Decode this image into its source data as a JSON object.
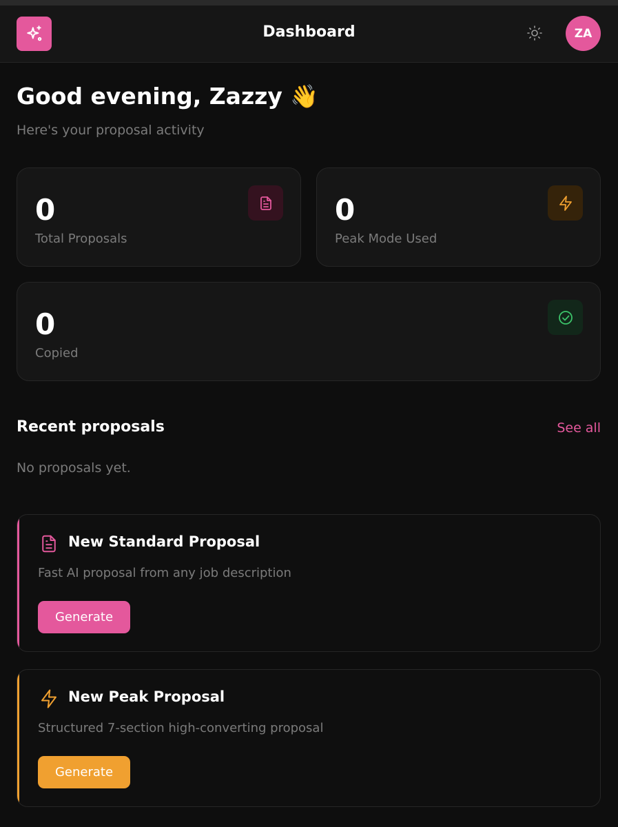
{
  "header": {
    "title": "Dashboard",
    "logo_icon": "sparkles-icon",
    "theme_icon": "sun-icon",
    "avatar_initials": "ZA"
  },
  "greeting": {
    "title": "Good evening, Zazzy 👋",
    "subtitle": "Here's your proposal activity"
  },
  "stats": [
    {
      "value": "0",
      "label": "Total Proposals",
      "icon": "document-icon",
      "color": "#e4589c"
    },
    {
      "value": "0",
      "label": "Peak Mode Used",
      "icon": "lightning-icon",
      "color": "#f0a030"
    },
    {
      "value": "0",
      "label": "Copied",
      "icon": "check-circle-icon",
      "color": "#3cc46a"
    }
  ],
  "recent": {
    "title": "Recent proposals",
    "see_all": "See all",
    "empty": "No proposals yet."
  },
  "actions": [
    {
      "title": "New Standard Proposal",
      "description": "Fast AI proposal from any job description",
      "button": "Generate",
      "icon": "document-icon",
      "color": "#e4589c"
    },
    {
      "title": "New Peak Proposal",
      "description": "Structured 7-section high-converting proposal",
      "button": "Generate",
      "icon": "lightning-icon",
      "color": "#f0a030"
    }
  ],
  "colors": {
    "accent_pink": "#e4589c",
    "accent_orange": "#f0a030",
    "accent_green": "#3cc46a",
    "background": "#0e0e0e",
    "card": "#161616"
  }
}
